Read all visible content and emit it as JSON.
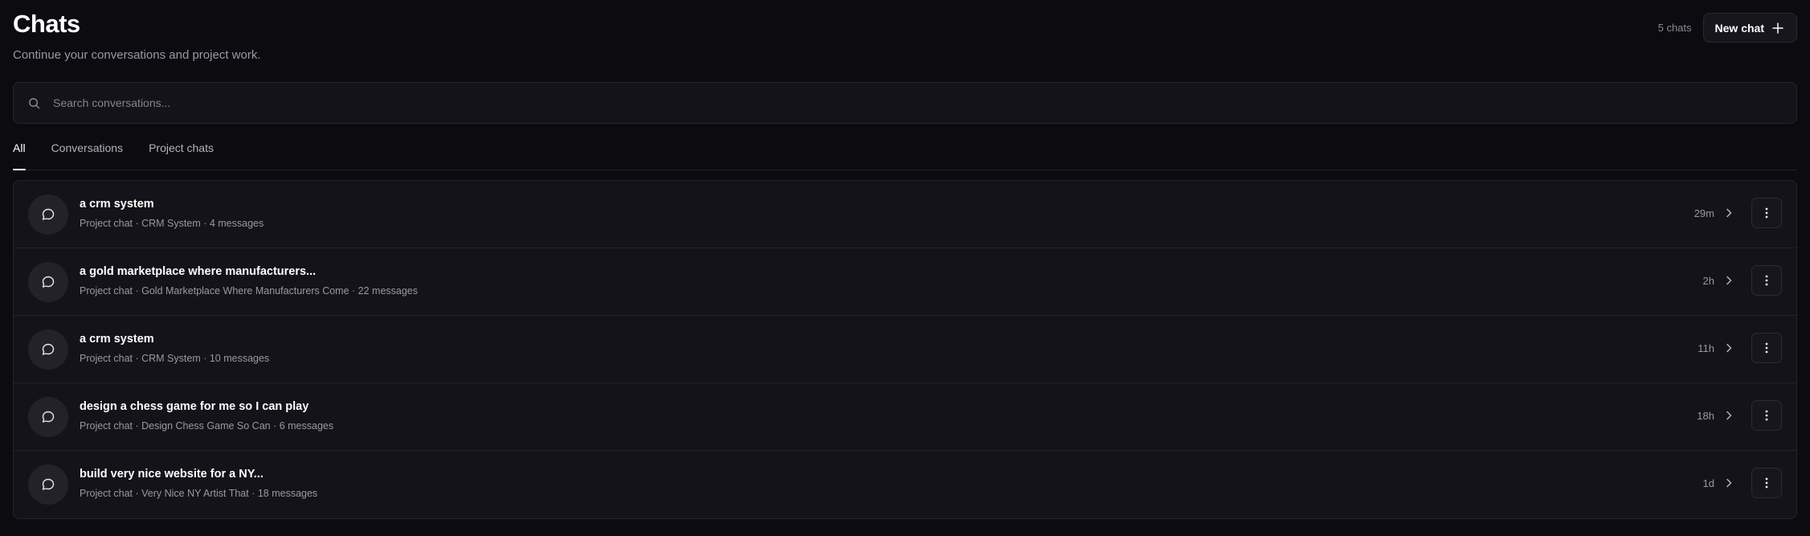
{
  "header": {
    "title": "Chats",
    "subtitle": "Continue your conversations and project work.",
    "chat_count": "5 chats",
    "new_chat_label": "New chat"
  },
  "search": {
    "placeholder": "Search conversations..."
  },
  "tabs": [
    {
      "label": "All",
      "active": true
    },
    {
      "label": "Conversations",
      "active": false
    },
    {
      "label": "Project chats",
      "active": false
    }
  ],
  "chats": [
    {
      "title": "a crm system",
      "meta": "Project chat · CRM System · 4 messages",
      "time": "29m"
    },
    {
      "title": "a gold marketplace where manufacturers...",
      "meta": "Project chat · Gold Marketplace Where Manufacturers Come · 22 messages",
      "time": "2h"
    },
    {
      "title": "a crm system",
      "meta": "Project chat · CRM System · 10 messages",
      "time": "11h"
    },
    {
      "title": "design a chess game for me so I can play",
      "meta": "Project chat · Design Chess Game So Can · 6 messages",
      "time": "18h"
    },
    {
      "title": "build very nice website for a NY...",
      "meta": "Project chat · Very Nice NY Artist That · 18 messages",
      "time": "1d"
    }
  ],
  "icons": {
    "search": "search-icon",
    "new_chat": "plus-icon",
    "chat": "chat-bubble-icon",
    "open": "chevron-right-icon",
    "more": "more-vertical-icon"
  },
  "colors": {
    "background": "#0c0b10",
    "surface": "#14131a",
    "border": "#24232a",
    "text_primary": "#ffffff",
    "text_secondary": "#9a98a3"
  }
}
